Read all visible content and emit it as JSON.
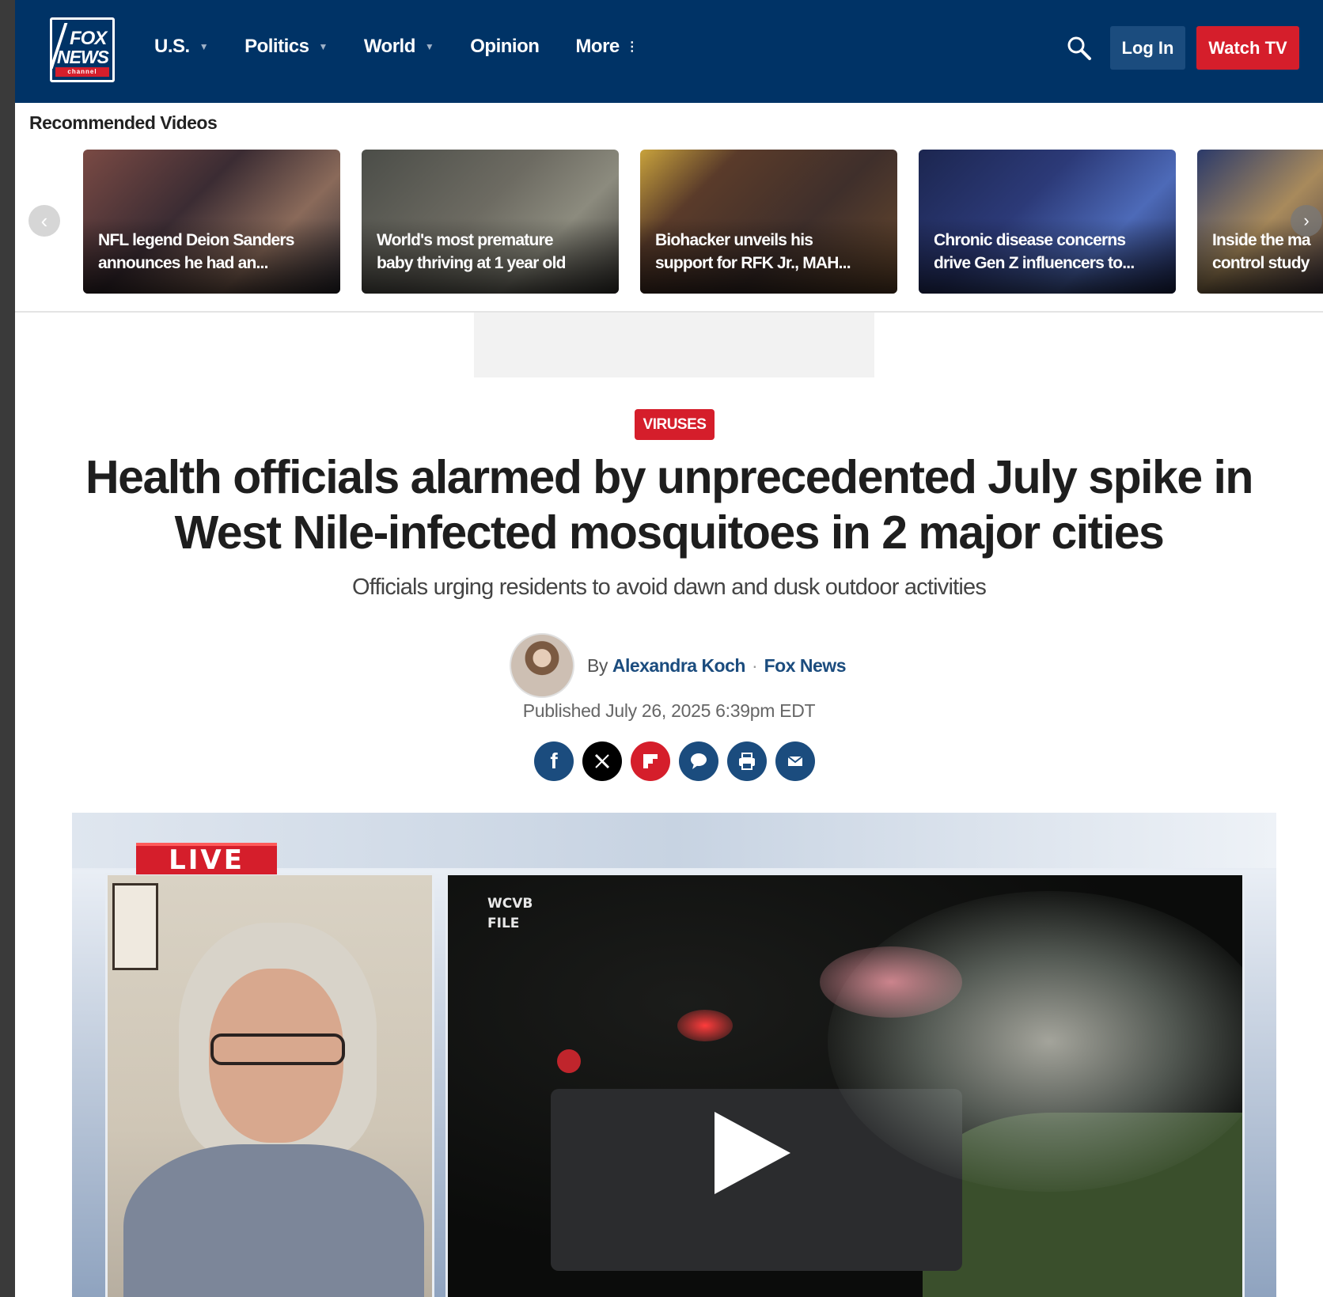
{
  "header": {
    "logo": {
      "line1": "FOX",
      "line2": "NEWS",
      "line3": "channel"
    },
    "nav": [
      {
        "label": "U.S.",
        "has_caret": true
      },
      {
        "label": "Politics",
        "has_caret": true
      },
      {
        "label": "World",
        "has_caret": true
      },
      {
        "label": "Opinion",
        "has_caret": false
      },
      {
        "label": "More",
        "has_caret": false
      }
    ],
    "search_icon": "search-icon",
    "login_label": "Log In",
    "watch_label": "Watch TV",
    "colors": {
      "bar": "#003366",
      "accent": "#d51e2b",
      "login": "#1b4c7e"
    }
  },
  "recommended": {
    "title": "Recommended Videos",
    "items": [
      {
        "caption_line1": "NFL legend Deion Sanders",
        "caption_line2": "announces he had an..."
      },
      {
        "caption_line1": "World's most premature",
        "caption_line2": "baby thriving at 1 year old"
      },
      {
        "caption_line1": "Biohacker unveils his",
        "caption_line2": "support for RFK Jr., MAH..."
      },
      {
        "caption_line1": "Chronic disease concerns",
        "caption_line2": "drive Gen Z influencers to..."
      },
      {
        "caption_line1": "Inside the ma",
        "caption_line2": "control study"
      }
    ]
  },
  "article": {
    "category": "VIRUSES",
    "headline": "Health officials alarmed by unprecedented July spike in West Nile-infected mosquitoes in 2 major cities",
    "subheadline": "Officials urging residents to avoid dawn and dusk outdoor activities",
    "by_prefix": "By",
    "author": "Alexandra Koch",
    "separator": "·",
    "outlet": "Fox News",
    "published": "Published July 26, 2025 6:39pm EDT",
    "share_icons": [
      "facebook-icon",
      "x-icon",
      "flipboard-icon",
      "comment-icon",
      "print-icon",
      "email-icon"
    ]
  },
  "video": {
    "live_label": "LIVE",
    "bug_text": "WCVB\nFILE"
  }
}
